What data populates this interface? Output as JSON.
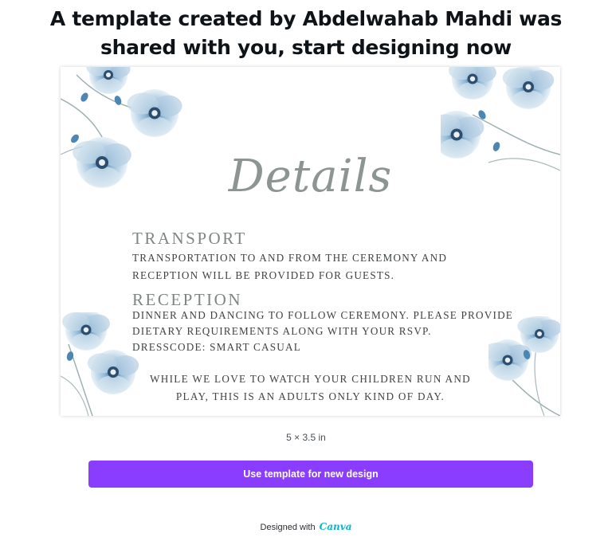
{
  "header": {
    "line1": "A template created by Abdelwahab Mahdi was",
    "line2": "shared with you, start designing now"
  },
  "card": {
    "title": "Details",
    "transport": {
      "heading": "TRANSPORT",
      "lines": [
        "TRANSPORTATION TO AND FROM THE CEREMONY AND",
        "RECEPTION WILL BE PROVIDED FOR GUESTS."
      ]
    },
    "reception": {
      "heading": "RECEPTION",
      "lines": [
        "DINNER AND DANCING TO FOLLOW CEREMONY. PLEASE PROVIDE",
        "DIETARY REQUIREMENTS ALONG WITH YOUR RSVP.",
        "DRESSCODE: SMART CASUAL"
      ]
    },
    "closing": {
      "lines": [
        "WHILE WE LOVE TO WATCH YOUR CHILDREN RUN AND",
        "PLAY, THIS IS AN ADULTS ONLY KIND OF DAY."
      ]
    },
    "decoration_icon": "blue-poppy-flowers-icon"
  },
  "dimensions": "5 × 3.5 in",
  "cta": {
    "label": "Use template for new design"
  },
  "footer": {
    "prefix": "Designed with",
    "brand": "Canva"
  },
  "colors": {
    "accent": "#8b3dff",
    "brand": "#00b9cf",
    "flower_blue": "#6f9fc4",
    "title_gray": "#8d9593"
  }
}
